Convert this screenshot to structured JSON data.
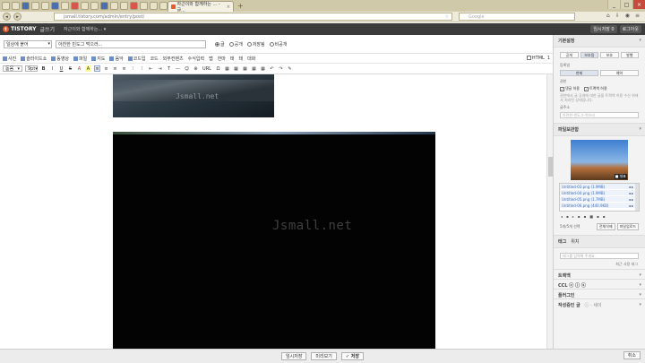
{
  "browser": {
    "pinned_tabs": [
      "",
      "",
      "",
      "",
      "",
      "",
      "",
      "",
      "",
      "",
      "",
      "",
      "",
      "",
      "",
      "",
      "",
      "",
      "",
      "",
      "",
      "",
      ""
    ],
    "active_tab": {
      "title": "자근이와 함께하는 ... - 글...",
      "close": "×"
    },
    "new_tab": "+",
    "window_buttons": [
      "_",
      "□",
      "×"
    ],
    "url": "jsmall.tistory.com/admin/entry/post/",
    "search_placeholder": "Google"
  },
  "tistory": {
    "logo_mark": "t",
    "logo": "TISTORY",
    "write_label": "글쓰기",
    "blog_select": "자근이와 함께하는... ▾",
    "header_buttons": [
      "임시저장 0",
      "로그아웃"
    ]
  },
  "editor": {
    "category": "일상에 붙어",
    "title_value": "아찬한 빈도그 먹으러...",
    "visibility": [
      "글",
      "공개",
      "저장됨",
      "비공개"
    ],
    "toolbar1": [
      "사진",
      "슬라이드쇼",
      "동영상",
      "파일",
      "지도",
      "음악",
      "코드입",
      "코드",
      "외부컨텐츠",
      "수식입력",
      "맵",
      "한마",
      "태",
      "태",
      "대화"
    ],
    "toolbar1_right": [
      "HTML",
      "1"
    ],
    "font_select": "돋움",
    "size_select": "9pt",
    "toolbar2": [
      "B",
      "I",
      "U",
      "S",
      "A",
      "A",
      "≡",
      "≡",
      "≡",
      "≡",
      "⁝",
      "⁝",
      "⇤",
      "⇥",
      "T",
      "—",
      "☺",
      "⊕",
      "URL",
      "Ω",
      "▦",
      "▦",
      "▦",
      "▦",
      "▦",
      "↶",
      "↷",
      "✎"
    ],
    "image_watermark": "Jsmall.net"
  },
  "actions": {
    "temp_save": "임시저장",
    "preview": "미리보기",
    "save": "✓ 저장",
    "cancel": "취소"
  },
  "sidebar": {
    "basic_settings": "기본설정",
    "publish_tabs": [
      "공개",
      "보호됨",
      "보호",
      "발행"
    ],
    "reg_label": "등록일",
    "reg_tabs": [
      "현재",
      "예약"
    ],
    "perm_label": "권한",
    "perm_checks": [
      "댓글 허용",
      "트랙백 허용"
    ],
    "perm_help": "권한에서 글 공개에 대한 글을 트랙백 허용 수신 위에서 처리된 상태입니다.",
    "address_label": "글주소",
    "address_placeholder": "아련한-빈도그-먹으러",
    "attach_header": "파일보관함",
    "thumb_rep": "■ 대표",
    "files": [
      {
        "name": "Untitled-03.png (1.9MB)",
        "ctl": "◂ ▸"
      },
      {
        "name": "Untitled-04.png (1.9MB)",
        "ctl": "◂ ▸"
      },
      {
        "name": "Untitled-05.png (1.7MB)",
        "ctl": "◂ ▸"
      },
      {
        "name": "Untitled-06.png (440.9KB)",
        "ctl": "◂ ▸"
      }
    ],
    "align_icons": [
      "◂",
      "▪",
      "▸",
      "▪",
      "▪",
      "■",
      "▪",
      "▪"
    ],
    "file_count_label": "5개/5개 선택",
    "file_buttons": [
      "전체삭제",
      "파일업로드"
    ],
    "tag_tab": "태그",
    "location_tab": "위치",
    "tag_placeholder": "태그를 입력해 주세요.",
    "recent_tags": "최근 사용 태그",
    "sections": [
      {
        "title": "트랙백",
        "extra": ""
      },
      {
        "title": "CCL ⓒ ⓘ ⓢ",
        "extra": ""
      },
      {
        "title": "플러그인",
        "extra": ""
      },
      {
        "title": "작성중인 글",
        "extra": "ⓘ  · 세이"
      }
    ],
    "caret": "▾"
  }
}
